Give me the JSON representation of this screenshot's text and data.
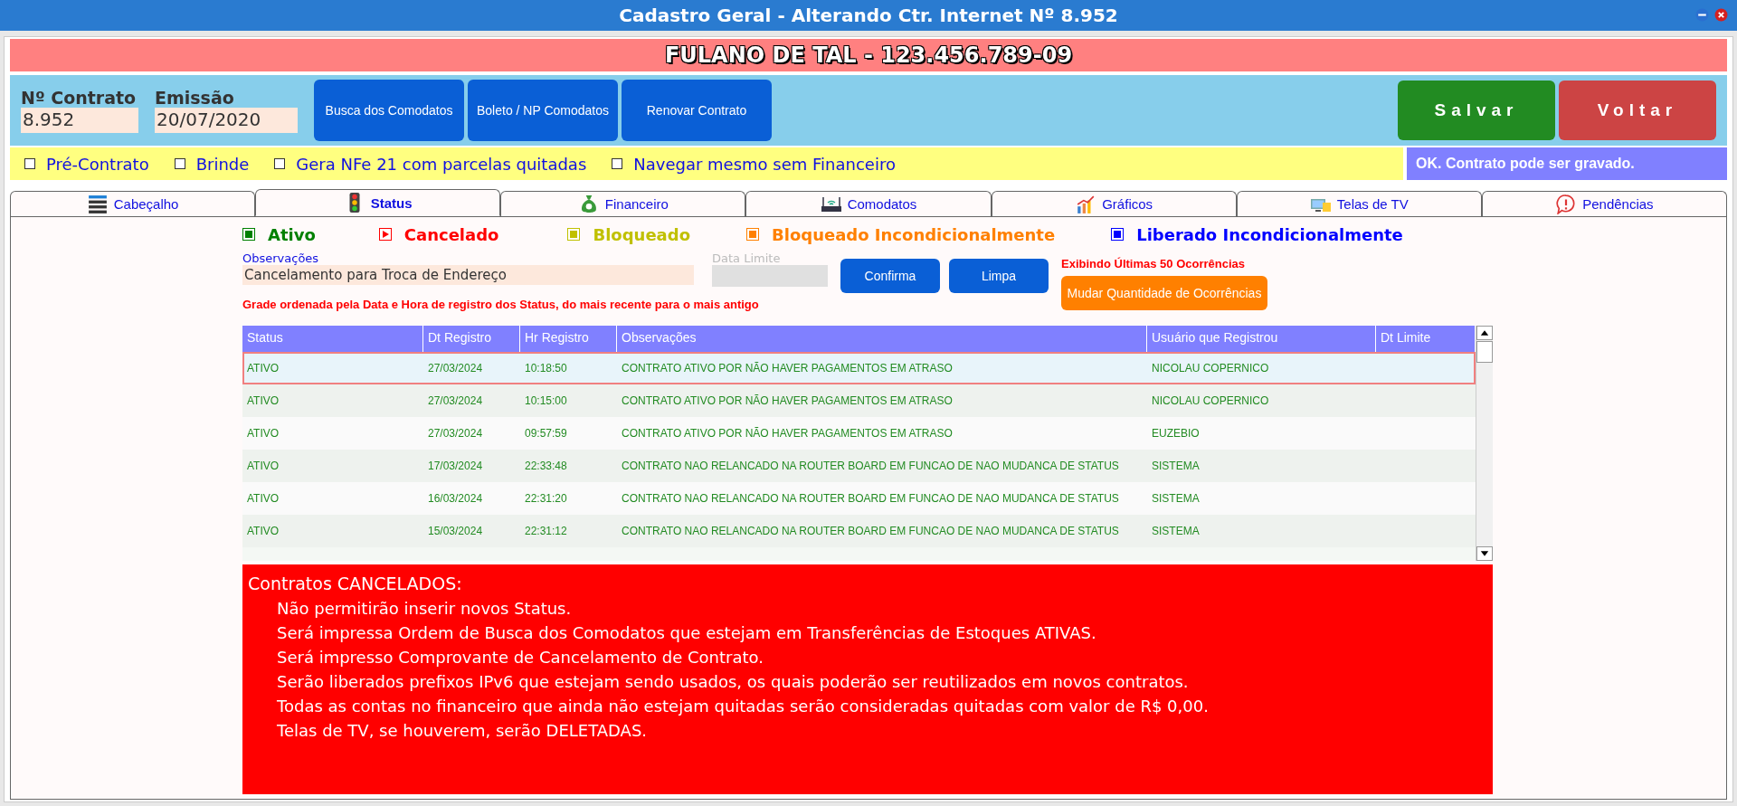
{
  "window": {
    "title": "Cadastro Geral - Alterando Ctr. Internet Nº 8.952"
  },
  "customer_banner": "FULANO DE TAL - 123.456.789-09",
  "contract_fields": [
    {
      "label": "Nº Contrato",
      "value": "8.952"
    },
    {
      "label": "Emissão",
      "value": "20/07/2020"
    }
  ],
  "action_buttons": [
    "Busca dos Comodatos",
    "Boleto / NP Comodatos",
    "Renovar Contrato"
  ],
  "main_buttons": [
    {
      "label": "Salvar",
      "kind": "save"
    },
    {
      "label": "Voltar",
      "kind": "back"
    }
  ],
  "options": [
    {
      "label": "Pré-Contrato",
      "checked": false
    },
    {
      "label": "Brinde",
      "checked": false
    },
    {
      "label": "Gera NFe 21 com parcelas quitadas",
      "checked": false
    },
    {
      "label": "Navegar mesmo sem Financeiro",
      "checked": false
    }
  ],
  "status_message": "OK. Contrato pode ser gravado.",
  "tabs": [
    {
      "label": "Cabeçalho",
      "selected": false
    },
    {
      "label": "Status",
      "selected": true
    },
    {
      "label": "Financeiro",
      "selected": false
    },
    {
      "label": "Comodatos",
      "selected": false
    },
    {
      "label": "Gráficos",
      "selected": false
    },
    {
      "label": "Telas de TV",
      "selected": false
    },
    {
      "label": "Pendências",
      "selected": false
    }
  ],
  "legend": [
    {
      "label": "Ativo",
      "color": "#008000",
      "kind": "square"
    },
    {
      "label": "Cancelado",
      "color": "#ff0000",
      "kind": "play"
    },
    {
      "label": "Bloqueado",
      "color": "#c0c000",
      "kind": "square"
    },
    {
      "label": "Bloqueado Incondicionalmente",
      "color": "#ff8000",
      "kind": "square"
    },
    {
      "label": "Liberado Incondicionalmente",
      "color": "#0000ff",
      "kind": "square"
    }
  ],
  "observations": {
    "label": "Observações",
    "value": "Cancelamento para Troca de Endereço"
  },
  "limit_date": {
    "label": "Data Limite",
    "disabled": true
  },
  "form_buttons": [
    "Confirma",
    "Limpa"
  ],
  "occurrences_note": "Exibindo Últimas 50 Ocorrências",
  "change_quantity_button": "Mudar Quantidade de Ocorrências",
  "sort_note": "Grade ordenada pela Data e Hora de registro dos Status, do mais recente para o mais antigo",
  "table": {
    "columns": [
      "Status",
      "Dt Registro",
      "Hr Registro",
      "Observações",
      "Usuário que Registrou",
      "Dt Limite"
    ],
    "rows": [
      {
        "cells": [
          "ATIVO",
          "27/03/2024",
          "10:18:50",
          "CONTRATO ATIVO POR NÃO HAVER PAGAMENTOS EM ATRASO",
          "NICOLAU COPERNICO"
        ],
        "selected": true
      },
      {
        "cells": [
          "ATIVO",
          "27/03/2024",
          "10:15:00",
          "CONTRATO ATIVO POR NÃO HAVER PAGAMENTOS EM ATRASO",
          "NICOLAU COPERNICO"
        ],
        "selected": false
      },
      {
        "cells": [
          "ATIVO",
          "27/03/2024",
          "09:57:59",
          "CONTRATO ATIVO POR NÃO HAVER PAGAMENTOS EM ATRASO",
          "EUZEBIO"
        ],
        "selected": false
      },
      {
        "cells": [
          "ATIVO",
          "17/03/2024",
          "22:33:48",
          "CONTRATO NAO RELANCADO NA ROUTER BOARD EM FUNCAO DE NAO MUDANCA DE STATUS",
          "SISTEMA"
        ],
        "selected": false
      },
      {
        "cells": [
          "ATIVO",
          "16/03/2024",
          "22:31:20",
          "CONTRATO NAO RELANCADO NA ROUTER BOARD EM FUNCAO DE NAO MUDANCA DE STATUS",
          "SISTEMA"
        ],
        "selected": false
      },
      {
        "cells": [
          "ATIVO",
          "15/03/2024",
          "22:31:12",
          "CONTRATO NAO RELANCADO NA ROUTER BOARD EM FUNCAO DE NAO MUDANCA DE STATUS",
          "SISTEMA"
        ],
        "selected": false
      }
    ]
  },
  "cancel_notice": {
    "title": "Contratos CANCELADOS:",
    "lines": [
      "Não permitirão inserir novos Status.",
      "Será impressa Ordem de Busca dos Comodatos que estejam em Transferências de Estoques ATIVAS.",
      "Será impresso Comprovante de Cancelamento de Contrato.",
      "Serão liberados prefixos IPv6 que estejam sendo usados, os quais poderão ser reutilizados em novos contratos.",
      "Todas as contas no financeiro que ainda não estejam quitadas serão consideradas quitadas com valor de R$ 0,00.",
      "Telas de TV, se houverem, serão DELETADAS."
    ]
  }
}
